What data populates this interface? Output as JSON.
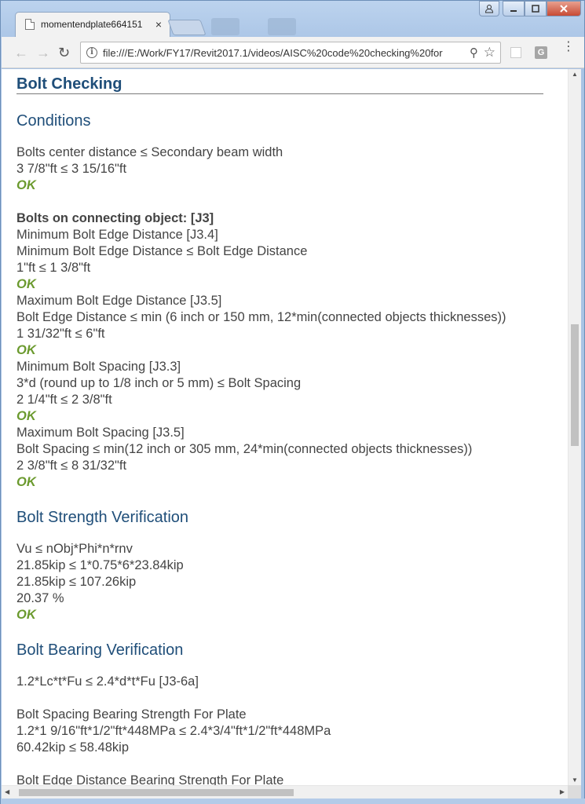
{
  "browser": {
    "tab_title": "momentendplate664151",
    "tab_close": "×",
    "url": "file:///E:/Work/FY17/Revit2017.1/videos/AISC%20code%20checking%20for",
    "ext_label": "G",
    "icons": [
      "user-icon",
      "minimize-icon",
      "maximize-icon",
      "close-icon",
      "back-icon",
      "forward-icon",
      "reload-icon",
      "info-icon",
      "zoom-icon",
      "star-icon",
      "menu-icon"
    ]
  },
  "page": {
    "heading": "Bolt Checking",
    "conditions": {
      "title": "Conditions",
      "centre_lines": [
        "Bolts center distance ≤ Secondary beam width",
        "3 7/8\"ft ≤ 3 15/16\"ft"
      ],
      "ok1": "OK",
      "connect_title": "Bolts on connecting object: [J3]",
      "min_edge": [
        "Minimum Bolt Edge Distance [J3.4]",
        "Minimum Bolt Edge Distance ≤ Bolt Edge Distance",
        "1\"ft ≤ 1 3/8\"ft"
      ],
      "ok2": "OK",
      "max_edge": [
        "Maximum Bolt Edge Distance [J3.5]",
        "Bolt Edge Distance ≤ min (6 inch or 150 mm, 12*min(connected objects thicknesses))",
        "1 31/32\"ft ≤ 6\"ft"
      ],
      "ok3": "OK",
      "min_spacing": [
        "Minimum Bolt Spacing [J3.3]",
        "3*d (round up to 1/8 inch or 5 mm) ≤ Bolt Spacing",
        "2 1/4\"ft ≤ 2 3/8\"ft"
      ],
      "ok4": "OK",
      "max_spacing": [
        "Maximum Bolt Spacing [J3.5]",
        "Bolt Spacing ≤ min(12 inch or 305 mm, 24*min(connected objects thicknesses))",
        "2 3/8\"ft ≤ 8 31/32\"ft"
      ],
      "ok5": "OK"
    },
    "strength": {
      "title": "Bolt Strength Verification",
      "lines": [
        "Vu ≤ nObj*Phi*n*rnv",
        "21.85kip ≤ 1*0.75*6*23.84kip",
        "21.85kip ≤ 107.26kip",
        "20.37 %"
      ],
      "ok": "OK"
    },
    "bearing": {
      "title": "Bolt Bearing Verification",
      "formula": "1.2*Lc*t*Fu ≤ 2.4*d*t*Fu [J3-6a]",
      "plate_lines": [
        "Bolt Spacing Bearing Strength For Plate",
        "1.2*1 9/16\"ft*1/2\"ft*448MPa ≤ 2.4*3/4\"ft*1/2\"ft*448MPa",
        "60.42kip ≤ 58.48kip"
      ],
      "cutoff": "Bolt Edge Distance Bearing Strength For Plate"
    }
  }
}
